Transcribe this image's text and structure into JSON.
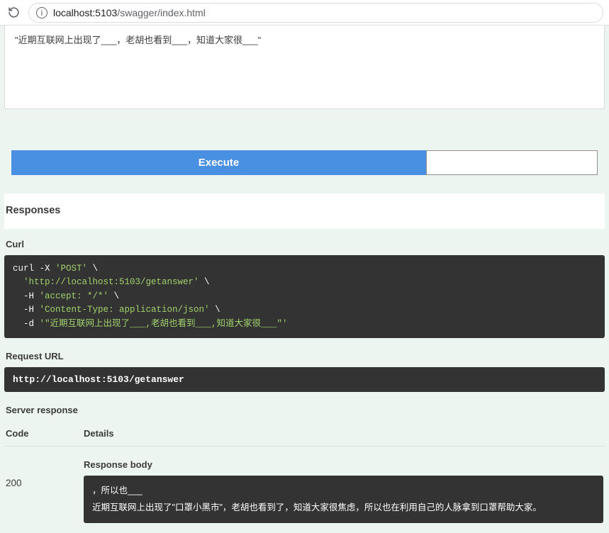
{
  "browser": {
    "url_host": "localhost:",
    "url_port": "5103",
    "url_path": "/swagger/index.html"
  },
  "request_body": "\"近期互联网上出现了___，老胡也看到___，知道大家很___\"",
  "buttons": {
    "execute": "Execute"
  },
  "responses_heading": "Responses",
  "curl": {
    "label": "Curl",
    "line1_cmd": "curl",
    "line1_rest": " -X ",
    "line1_method": "'POST'",
    "line2": "  'http://localhost:5103/getanswer'",
    "line3_flag": "  -H ",
    "line3_val": "'accept: */*'",
    "line4_flag": "  -H ",
    "line4_val": "'Content-Type: application/json'",
    "line5_flag": "  -d ",
    "line5_val": "'\"近期互联网上出现了___,老胡也看到___,知道大家很___\"'"
  },
  "request_url": {
    "label": "Request URL",
    "value": "http://localhost:5103/getanswer"
  },
  "server_response": {
    "label": "Server response",
    "code_header": "Code",
    "details_header": "Details",
    "code": "200",
    "response_body_label": "Response body",
    "body_line1": "，所以也___",
    "body_line2": "近期互联网上出现了\"口罩小黑市\"，老胡也看到了，知道大家很焦虑，所以也在利用自己的人脉拿到口罩帮助大家。"
  }
}
